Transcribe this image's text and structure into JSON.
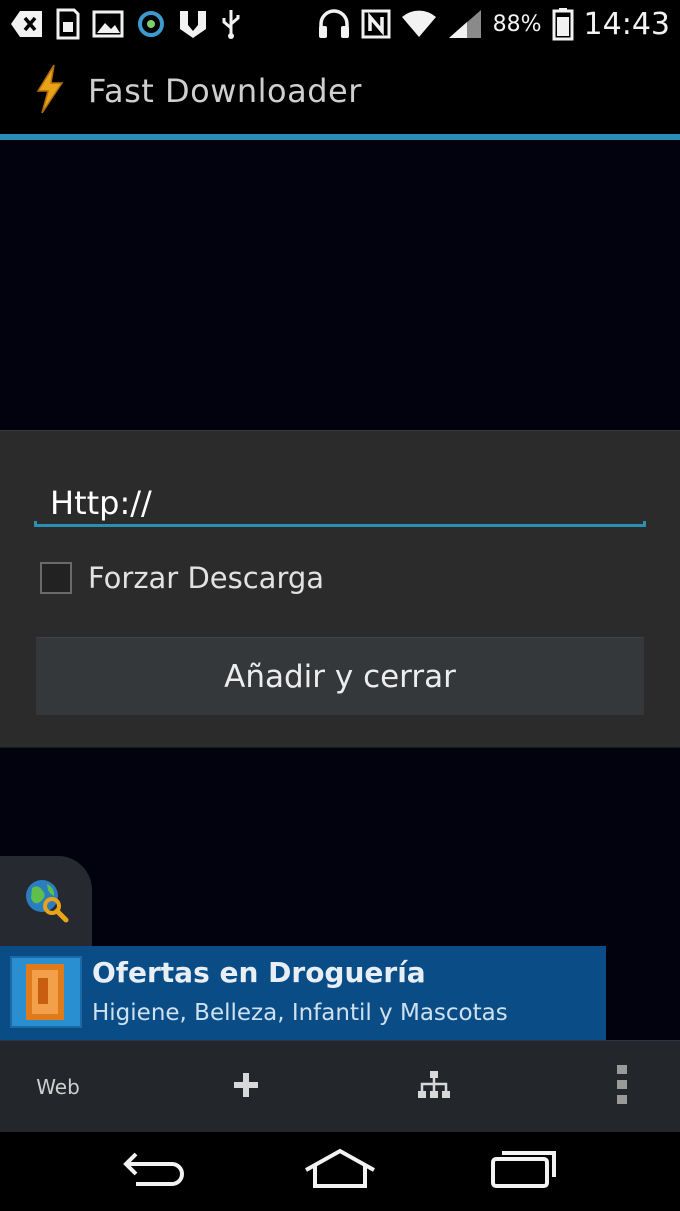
{
  "status_bar": {
    "battery_percent": "88%",
    "time": "14:43",
    "icons": [
      "back-arrow-icon",
      "sd-card-icon",
      "image-icon",
      "sync-icon",
      "shield-icon",
      "usb-icon",
      "headset-icon",
      "nfc-icon",
      "wifi-icon",
      "signal-icon",
      "battery-icon"
    ]
  },
  "action_bar": {
    "title": "Fast Downloader",
    "accent_color": "#2b8fb5",
    "logo_icon": "lightning-bolt-icon"
  },
  "dialog": {
    "url_value": "Http://",
    "force_download_label": "Forzar Descarga",
    "force_download_checked": false,
    "add_button_label": "Añadir y cerrar"
  },
  "ad": {
    "title": "Ofertas en Droguería",
    "subtitle": "Higiene, Belleza, Infantil y Mascotas",
    "background": "#0a4d86"
  },
  "toolbar": {
    "web_label": "Web",
    "icons": [
      "plus-icon",
      "tree-icon",
      "overflow-menu-icon"
    ]
  },
  "nav_bar": {
    "icons": [
      "back-icon",
      "home-icon",
      "recent-apps-icon"
    ]
  }
}
